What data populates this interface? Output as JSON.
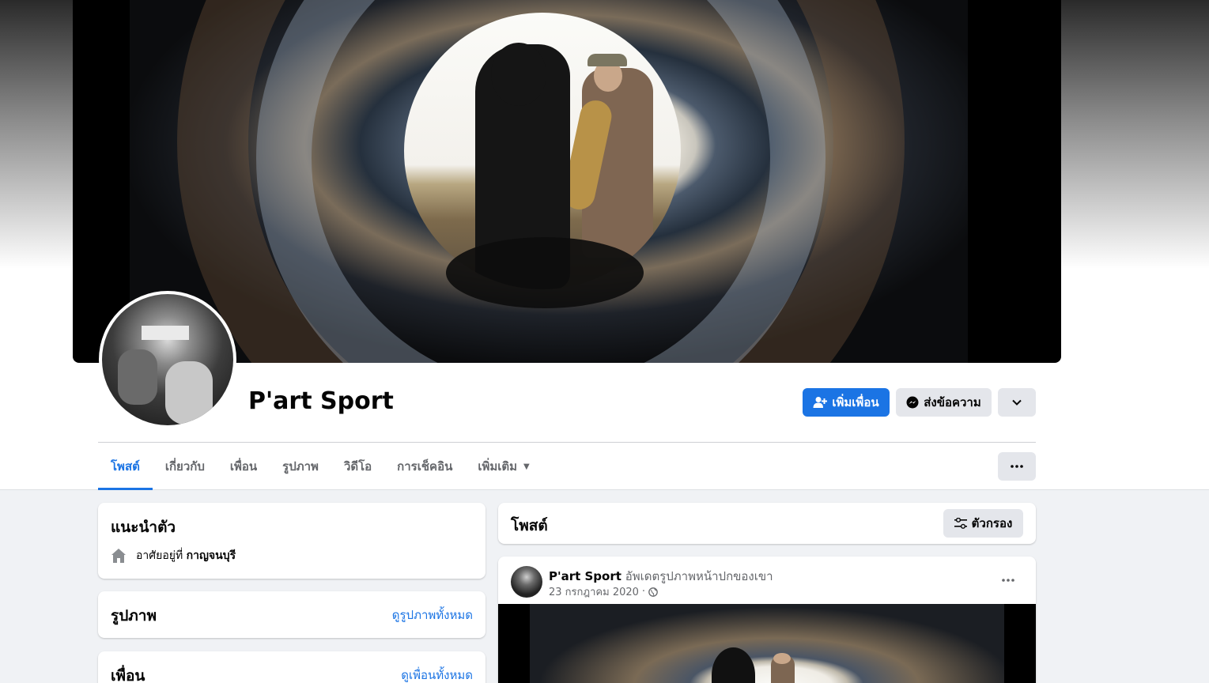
{
  "profile": {
    "name": "P'art Sport"
  },
  "actions": {
    "add_friend": "เพิ่มเพื่อน",
    "message": "ส่งข้อความ"
  },
  "tabs": [
    {
      "label": "โพสต์"
    },
    {
      "label": "เกี่ยวกับ"
    },
    {
      "label": "เพื่อน"
    },
    {
      "label": "รูปภาพ"
    },
    {
      "label": "วิดีโอ"
    },
    {
      "label": "การเช็คอิน"
    },
    {
      "label": "เพิ่มเติม"
    }
  ],
  "intro": {
    "title": "แนะนำตัว",
    "lives_prefix": "อาศัยอยู่ที่",
    "lives_place": "กาญจนบุรี"
  },
  "photos": {
    "title": "รูปภาพ",
    "link": "ดูรูปภาพทั้งหมด"
  },
  "friends": {
    "title": "เพื่อน",
    "link": "ดูเพื่อนทั้งหมด"
  },
  "posts": {
    "title": "โพสต์",
    "filter": "ตัวกรอง"
  },
  "post": {
    "author": "P'art Sport",
    "action": "อัพเดตรูปภาพหน้าปกของเขา",
    "date": "23 กรกฎาคม 2020",
    "separator": "·"
  },
  "colors": {
    "accent": "#1b74e4",
    "page_bg": "#f0f2f5",
    "button_bg": "#e4e6eb",
    "secondary_text": "#65676b"
  }
}
